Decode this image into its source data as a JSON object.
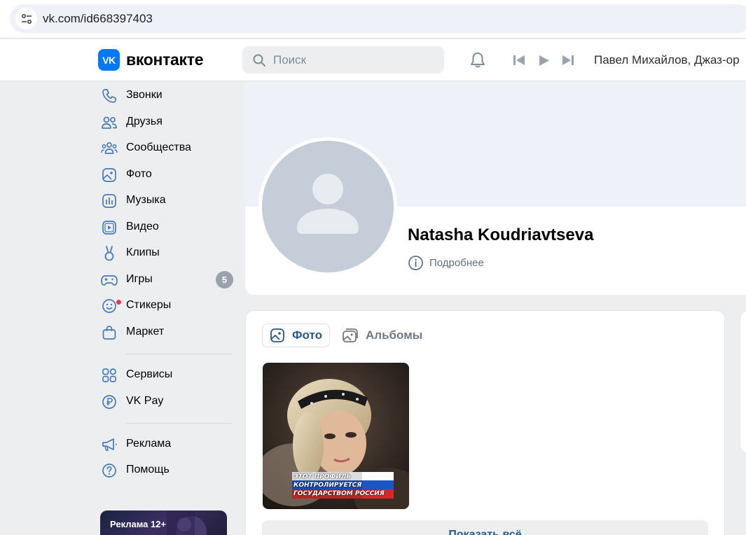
{
  "browser": {
    "url": "vk.com/id668397403"
  },
  "header": {
    "logo_badge": "VK",
    "logo_text": "вконтакте",
    "search_placeholder": "Поиск",
    "now_playing": "Павел Михайлов, Джаз-ор"
  },
  "sidebar": {
    "items": [
      {
        "label": "Звонки",
        "icon": "phone-icon"
      },
      {
        "label": "Друзья",
        "icon": "friends-icon"
      },
      {
        "label": "Сообщества",
        "icon": "communities-icon"
      },
      {
        "label": "Фото",
        "icon": "photo-icon"
      },
      {
        "label": "Музыка",
        "icon": "music-icon"
      },
      {
        "label": "Видео",
        "icon": "video-icon"
      },
      {
        "label": "Клипы",
        "icon": "clips-icon"
      },
      {
        "label": "Игры",
        "icon": "games-icon",
        "badge": "5"
      },
      {
        "label": "Стикеры",
        "icon": "stickers-icon"
      },
      {
        "label": "Маркет",
        "icon": "market-icon"
      },
      {
        "label": "Сервисы",
        "icon": "services-icon"
      },
      {
        "label": "VK Pay",
        "icon": "vkpay-icon"
      },
      {
        "label": "Реклама",
        "icon": "megaphone-icon"
      },
      {
        "label": "Помощь",
        "icon": "help-icon"
      }
    ],
    "ad_label": "Реклама 12+"
  },
  "profile": {
    "name": "Natasha Koudriavtseva",
    "more_label": "Подробнее"
  },
  "photos": {
    "tab_photos": "Фото",
    "tab_albums": "Альбомы",
    "overlay_lines": [
      "ЭТОТ ПРОФИЛЬ",
      "КОНТРОЛИРУЕТСЯ",
      "ГОСУДАРСТВОМ РОССИЯ"
    ],
    "show_all": "Показать всё"
  },
  "colors": {
    "accent": "#0077ff",
    "link": "#2a5885",
    "background": "#edeef0",
    "icon": "#447bba"
  }
}
